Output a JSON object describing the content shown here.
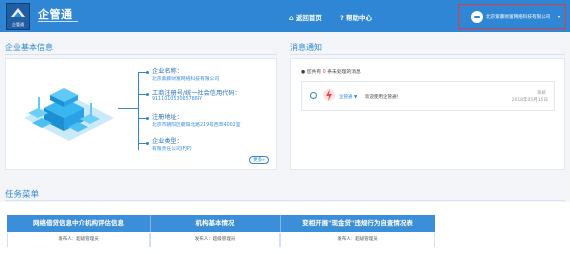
{
  "header": {
    "app_title": "企管通",
    "logo_sub": "企管通",
    "nav_home": "返回首页",
    "nav_help": "帮助中心",
    "user_name": "北京紫藤财富网络科技有限公司",
    "home_icon": "home-icon",
    "help_icon": "help-icon",
    "colors": {
      "bar": "#2f86d4",
      "highlight_border": "#e53a3a"
    }
  },
  "company": {
    "section_title": "企业基本信息",
    "fields": [
      {
        "label": "企业名称：",
        "value": "北京紫藤财富网络科技有限公司"
      },
      {
        "label": "工商注册号/统一社会信用代码：",
        "value": "911101053065788IY"
      },
      {
        "label": "注册地址：",
        "value": "北京市朝阳区朝阳北路219号西草4002室"
      },
      {
        "label": "企业类型：",
        "value": "有限责任公司(FJP)"
      }
    ],
    "more_label": "更多»"
  },
  "messages": {
    "section_title": "消息通知",
    "summary_prefix": "您共有",
    "summary_count": "0",
    "summary_suffix": "条未处理的消息",
    "items": [
      {
        "from": "企管通 ▼",
        "text": "欢迎使用企管通！",
        "type": "系统",
        "date": "2018年05月15日"
      }
    ]
  },
  "tasks": {
    "section_title": "任务菜单",
    "columns": [
      {
        "header": "网络借贷信息中介机构评估信息",
        "issuer": "发布人：超级管理员"
      },
      {
        "header": "机构基本情况",
        "issuer": "发布人：超级管理员"
      },
      {
        "header": "变相开展\"现金贷\"违规行为自查情况表",
        "issuer": "发布人：超级管理员"
      }
    ]
  }
}
